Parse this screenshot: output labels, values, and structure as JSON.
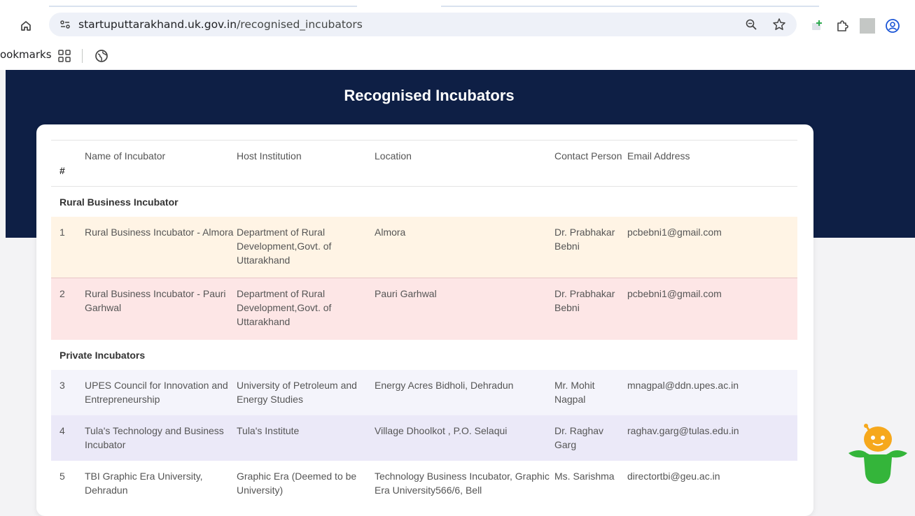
{
  "browser": {
    "url_host": "startuputtarakhand.uk.gov.in",
    "url_path": "/recognised_incubators",
    "bookmarks_label": "ookmarks",
    "icons": [
      "home-icon",
      "site-info-icon",
      "zoom-icon",
      "star-icon",
      "extension-add-icon",
      "puzzle-icon",
      "profile-icon",
      "apps-grid-icon",
      "globe-icon"
    ]
  },
  "page": {
    "title": "Recognised Incubators"
  },
  "table": {
    "headers": {
      "num": "#",
      "name": "Name of Incubator",
      "host": "Host Institution",
      "location": "Location",
      "contact": "Contact Person",
      "email": "Email Address"
    },
    "sections": [
      {
        "title": "Rural Business Incubator",
        "rows": [
          {
            "num": "1",
            "name": "Rural Business Incubator - Almora",
            "host": "Department of Rural Development,Govt. of Uttarakhand",
            "location": "Almora",
            "contact": "Dr. Prabhakar Bebni",
            "email": "pcbebni1@gmail.com"
          },
          {
            "num": "2",
            "name": "Rural Business Incubator - Pauri Garhwal",
            "host": "Department of Rural Development,Govt. of Uttarakhand",
            "location": "Pauri Garhwal",
            "contact": "Dr. Prabhakar Bebni",
            "email": "pcbebni1@gmail.com"
          }
        ]
      },
      {
        "title": "Private Incubators",
        "rows": [
          {
            "num": "3",
            "name": "UPES Council for Innovation and Entrepreneurship",
            "host": "University of Petroleum and Energy Studies",
            "location": "Energy Acres Bidholi, Dehradun",
            "contact": "Mr. Mohit Nagpal",
            "email": "mnagpal@ddn.upes.ac.in"
          },
          {
            "num": "4",
            "name": "Tula's Technology and Business Incubator",
            "host": "Tula's Institute",
            "location": "Village Dhoolkot , P.O. Selaqui",
            "contact": "Dr. Raghav Garg",
            "email": "raghav.garg@tulas.edu.in"
          },
          {
            "num": "5",
            "name": "TBI Graphic Era University, Dehradun",
            "host": "Graphic Era (Deemed to be University)",
            "location": "Technology Business Incubator, Graphic Era University566/6, Bell",
            "contact": "Ms. Sarishma",
            "email": "directortbi@geu.ac.in"
          }
        ]
      }
    ]
  },
  "colors": {
    "hero": "#0e1f45",
    "row_orange": "#fff4e5",
    "row_pink": "#fde6e6",
    "row_lavender": "#f4f4fb",
    "row_purple": "#ebe9f8"
  }
}
